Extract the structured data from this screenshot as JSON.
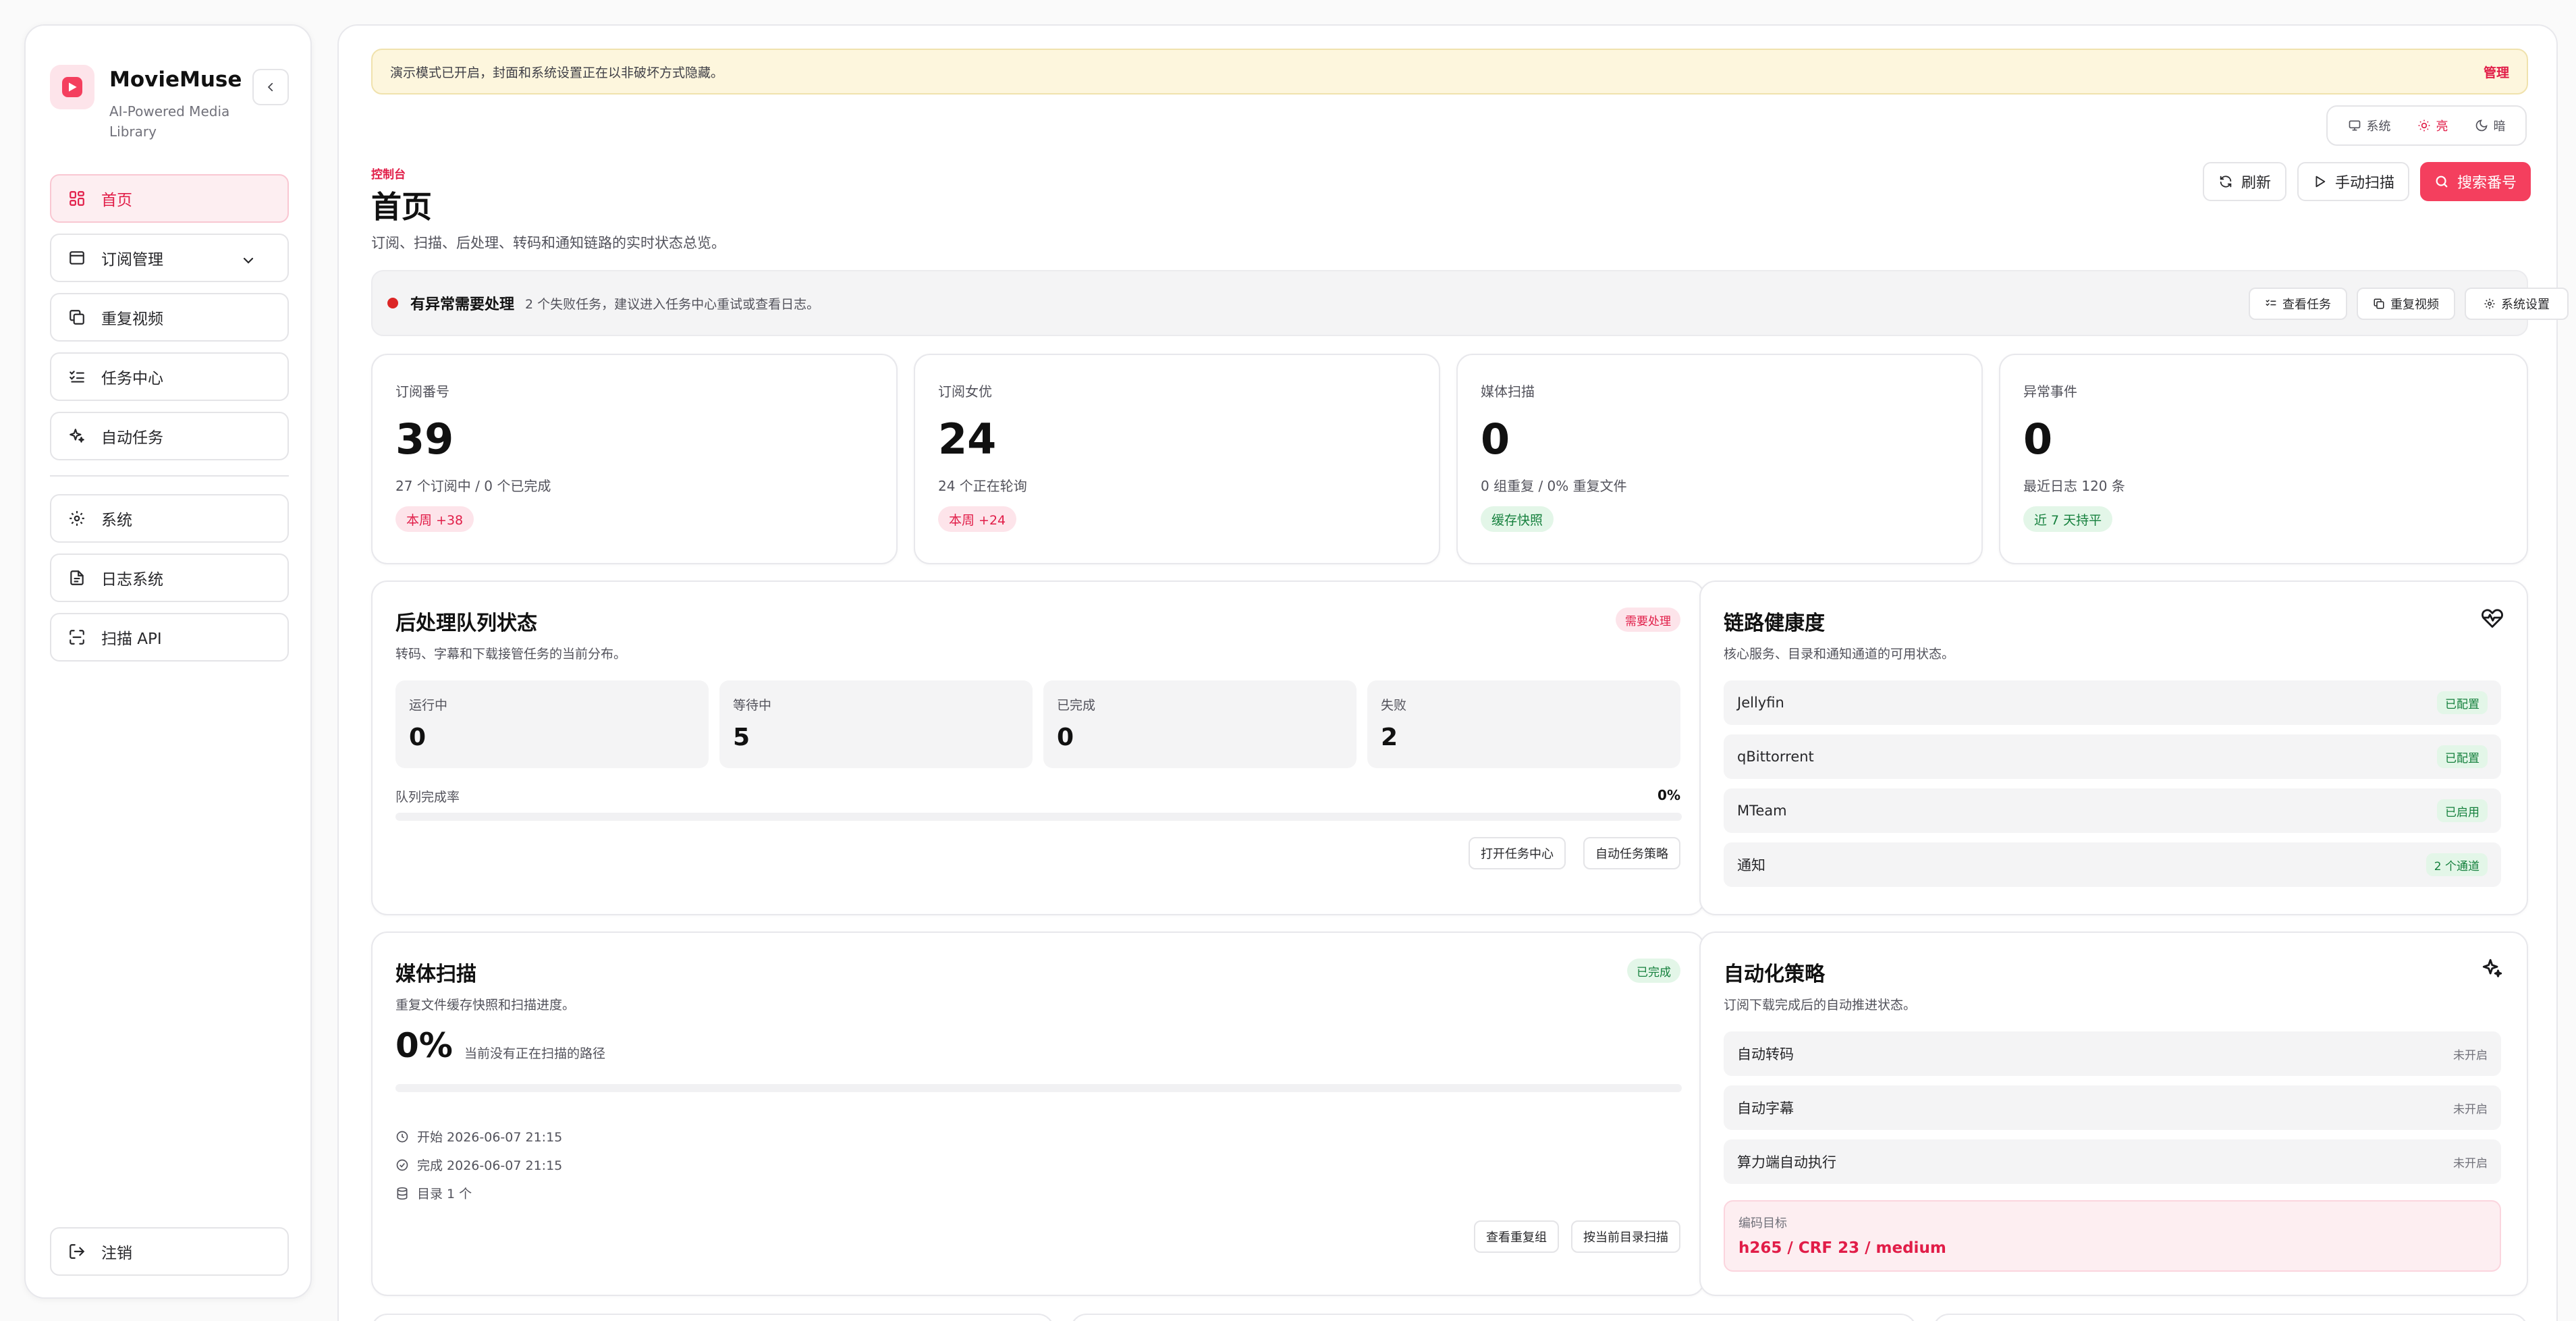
{
  "brand": {
    "name": "MovieMuse",
    "subtitle": "AI-Powered Media Library"
  },
  "sidebar": {
    "items": [
      {
        "label": "首页",
        "icon": "dashboard-icon",
        "active": true
      },
      {
        "label": "订阅管理",
        "icon": "subscription-icon",
        "expandable": true
      },
      {
        "label": "重复视频",
        "icon": "duplicate-icon"
      },
      {
        "label": "任务中心",
        "icon": "task-list-icon"
      },
      {
        "label": "自动任务",
        "icon": "sparkles-icon"
      }
    ],
    "secondary_items": [
      {
        "label": "系统",
        "icon": "gear-icon"
      },
      {
        "label": "日志系统",
        "icon": "log-file-icon"
      },
      {
        "label": "扫描 API",
        "icon": "scan-icon"
      }
    ],
    "logout_label": "注销"
  },
  "banner": {
    "text": "演示模式已开启，封面和系统设置正在以非破坏方式隐藏。",
    "action": "管理"
  },
  "theme": {
    "options": [
      "系统",
      "亮",
      "暗"
    ],
    "selected": "亮"
  },
  "header": {
    "eyebrow": "控制台",
    "title": "首页",
    "description": "订阅、扫描、后处理、转码和通知链路的实时状态总览。",
    "buttons": {
      "refresh": "刷新",
      "manual_scan": "手动扫描",
      "search": "搜索番号"
    }
  },
  "alert": {
    "title": "有异常需要处理",
    "description": "2 个失败任务，建议进入任务中心重试或查看日志。",
    "buttons": {
      "view_tasks": "查看任务",
      "duplicates": "重复视频",
      "settings": "系统设置"
    }
  },
  "stats": [
    {
      "label": "订阅番号",
      "value": "39",
      "sub": "27 个订阅中 / 0 个已完成",
      "pill": "本周 +38",
      "pill_tone": "pink"
    },
    {
      "label": "订阅女优",
      "value": "24",
      "sub": "24 个正在轮询",
      "pill": "本周 +24",
      "pill_tone": "pink"
    },
    {
      "label": "媒体扫描",
      "value": "0",
      "sub": "0 组重复 / 0% 重复文件",
      "pill": "缓存快照",
      "pill_tone": "green"
    },
    {
      "label": "异常事件",
      "value": "0",
      "sub": "最近日志 120 条",
      "pill": "近 7 天持平",
      "pill_tone": "green"
    }
  ],
  "queue": {
    "title": "后处理队列状态",
    "description": "转码、字幕和下载接管任务的当前分布。",
    "badge": "需要处理",
    "tiles": [
      {
        "label": "运行中",
        "value": "0"
      },
      {
        "label": "等待中",
        "value": "5"
      },
      {
        "label": "已完成",
        "value": "0"
      },
      {
        "label": "失败",
        "value": "2"
      }
    ],
    "progress_label": "队列完成率",
    "progress_text": "0%",
    "progress_value": 0,
    "buttons": {
      "open_tasks": "打开任务中心",
      "auto_policy": "自动任务策略"
    }
  },
  "health": {
    "title": "链路健康度",
    "description": "核心服务、目录和通知通道的可用状态。",
    "rows": [
      {
        "name": "Jellyfin",
        "status": "已配置"
      },
      {
        "name": "qBittorrent",
        "status": "已配置"
      },
      {
        "name": "MTeam",
        "status": "已启用"
      },
      {
        "name": "通知",
        "status": "2 个通道"
      }
    ]
  },
  "scan": {
    "title": "媒体扫描",
    "description": "重复文件缓存快照和扫描进度。",
    "badge": "已完成",
    "percent_text": "0%",
    "progress_value": 0,
    "note": "当前没有正在扫描的路径",
    "start": "开始 2026-06-07 21:15",
    "finish": "完成 2026-06-07 21:15",
    "dirs": "目录 1 个",
    "buttons": {
      "view_duplicates": "查看重复组",
      "scan_current": "按当前目录扫描"
    }
  },
  "automation": {
    "title": "自动化策略",
    "description": "订阅下载完成后的自动推进状态。",
    "rows": [
      {
        "name": "自动转码",
        "status": "未开启"
      },
      {
        "name": "自动字幕",
        "status": "未开启"
      },
      {
        "name": "算力端自动执行",
        "status": "未开启"
      }
    ],
    "encode_label": "编码目标",
    "encode_value": "h265 / CRF 23 / medium"
  },
  "colors": {
    "accent": "#f43f5e",
    "accent_text": "#e11d48",
    "success": "#15803d",
    "warning_bg": "#fdf6dd"
  }
}
